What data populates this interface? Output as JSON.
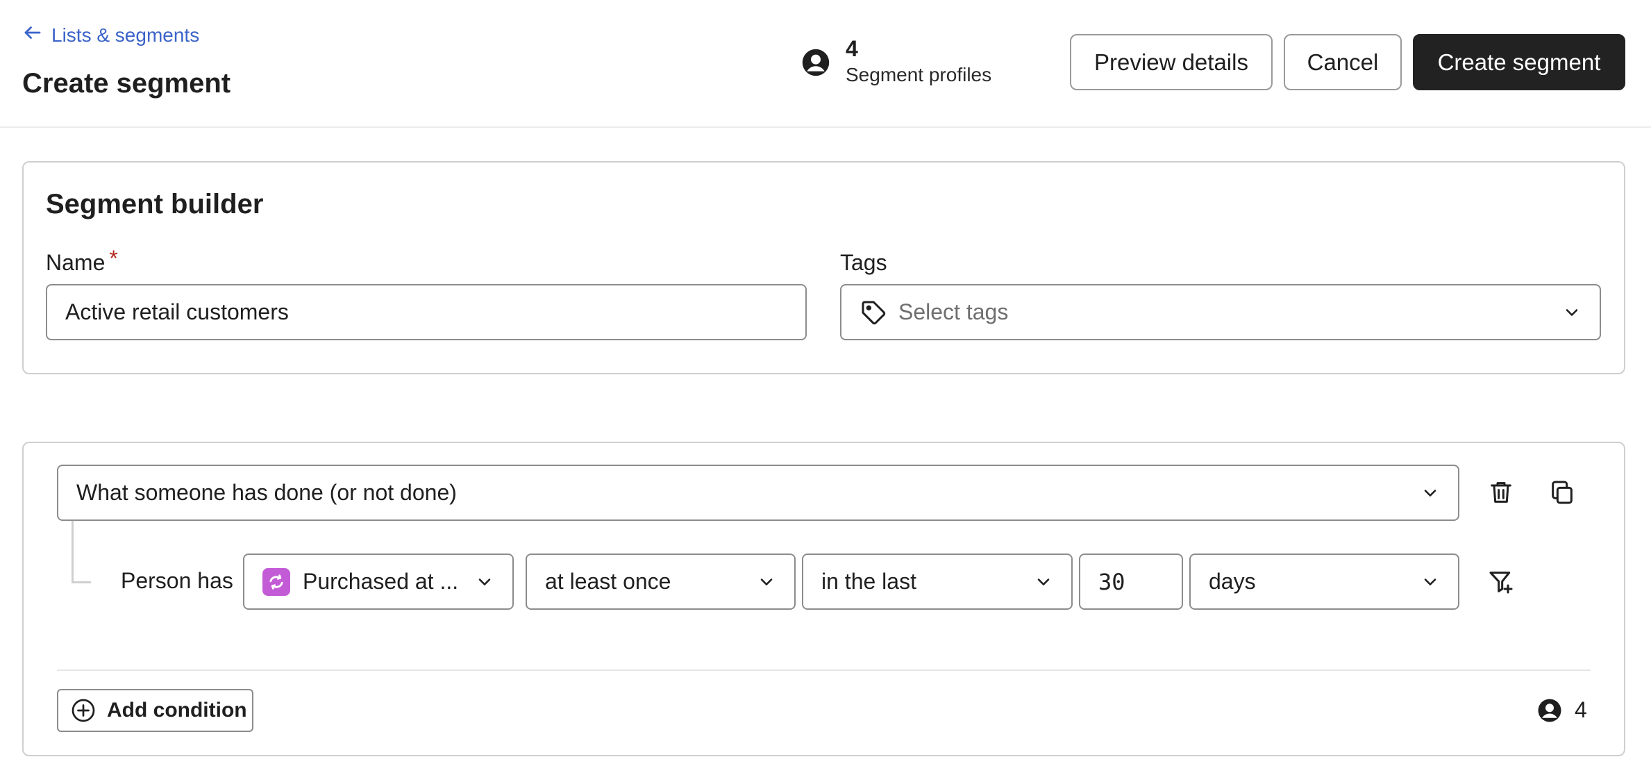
{
  "header": {
    "back_label": "Lists & segments",
    "title": "Create segment",
    "profiles_count": "4",
    "profiles_label": "Segment profiles",
    "preview_label": "Preview details",
    "cancel_label": "Cancel",
    "create_label": "Create segment"
  },
  "builder": {
    "title": "Segment builder",
    "name_label": "Name",
    "required_mark": "*",
    "name_value": "Active retail customers",
    "tags_label": "Tags",
    "tags_placeholder": "Select tags"
  },
  "condition": {
    "type_value": "What someone has done (or not done)",
    "person_has_label": "Person has",
    "metric_value": "Purchased at ...",
    "frequency_value": "at least once",
    "timeframe_value": "in the last",
    "number_value": "30",
    "unit_value": "days",
    "add_condition_label": "Add condition",
    "matching_count": "4"
  },
  "colors": {
    "link": "#3b63c9",
    "primary_button": "#222222",
    "required": "#b3261e",
    "metric_icon": "#c35bd6"
  },
  "icons": {
    "back": "arrow-left-icon",
    "profiles": "user-circle-icon",
    "tags": "tag-icon",
    "dropdown": "chevron-down-icon",
    "delete": "trash-icon",
    "duplicate": "copy-icon",
    "metric": "integration-icon",
    "add_filter": "filter-plus-icon",
    "add_condition": "plus-circle-icon"
  }
}
